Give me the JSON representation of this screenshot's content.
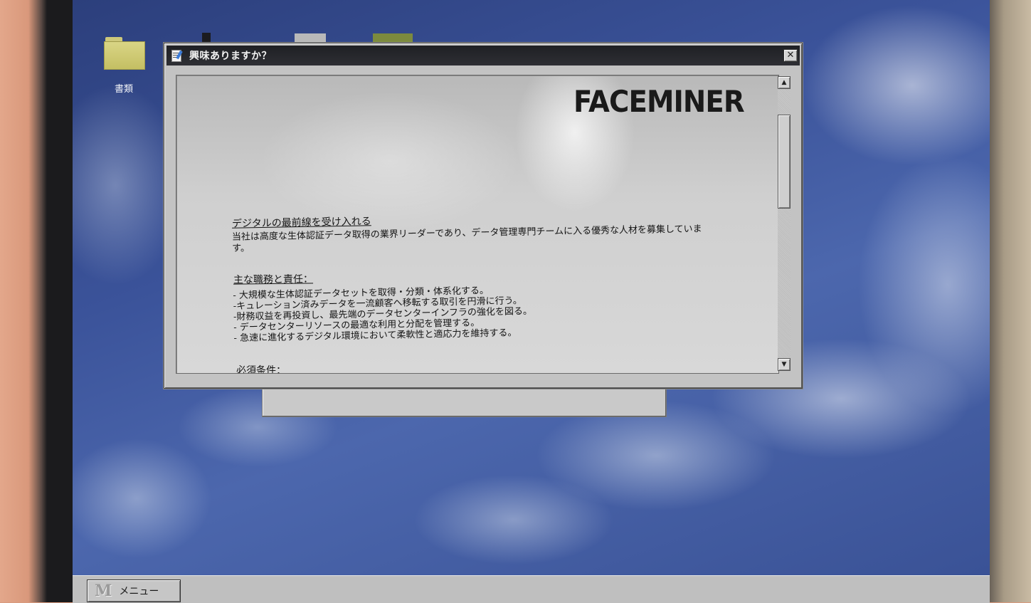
{
  "desktop": {
    "icons": [
      {
        "label": "書類"
      }
    ]
  },
  "dialog": {
    "title": "興味ありますか？",
    "close_glyph": "✕",
    "logo": "FACEMINER",
    "heading": "デジタルの最前線を受け入れる",
    "intro": "当社は高度な生体認証データ取得の業界リーダーであり、データ管理専門チームに入る優秀な人材を募集しています。",
    "duties_heading": "主な職務と責任：",
    "duties": [
      "- 大規模な生体認証データセットを取得・分類・体系化する。",
      "-キュレーション済みデータを一流顧客へ移転する取引を円滑に行う。",
      "-財務収益を再投資し、最先端のデータセンターインフラの強化を図る。",
      "- データセンターリソースの最適な利用と分配を管理する。",
      "- 急速に進化するデジタル環境において柔軟性と適応力を維持する。"
    ],
    "requirements_heading": "必須条件：",
    "scroll_up_glyph": "▲",
    "scroll_down_glyph": "▼"
  },
  "taskbar": {
    "menu_logo": "M",
    "menu_label": "メニュー"
  }
}
